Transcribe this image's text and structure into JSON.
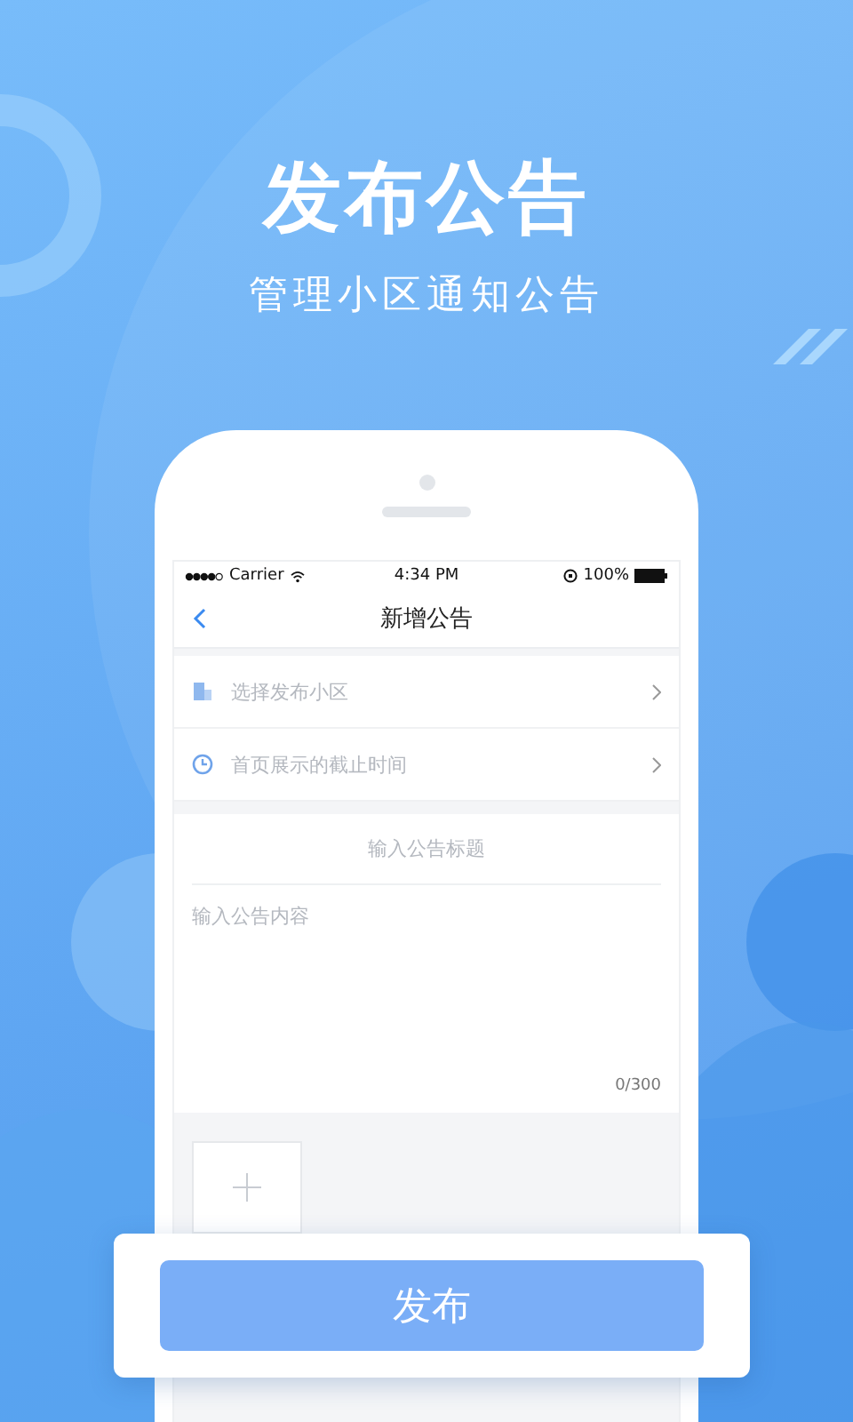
{
  "headline": "发布公告",
  "subtitle": "管理小区通知公告",
  "phone": {
    "status_bar": {
      "carrier": "Carrier",
      "time": "4:34 PM",
      "battery": "100%"
    },
    "nav_title": "新增公告",
    "rows": [
      {
        "kind": "building",
        "label": "选择发布小区"
      },
      {
        "kind": "clock",
        "label": "首页展示的截止时间"
      }
    ],
    "title_field": {
      "placeholder": "输入公告标题"
    },
    "content_field": {
      "placeholder": "输入公告内容",
      "counter": "0/300"
    }
  },
  "publish_button": "发布"
}
